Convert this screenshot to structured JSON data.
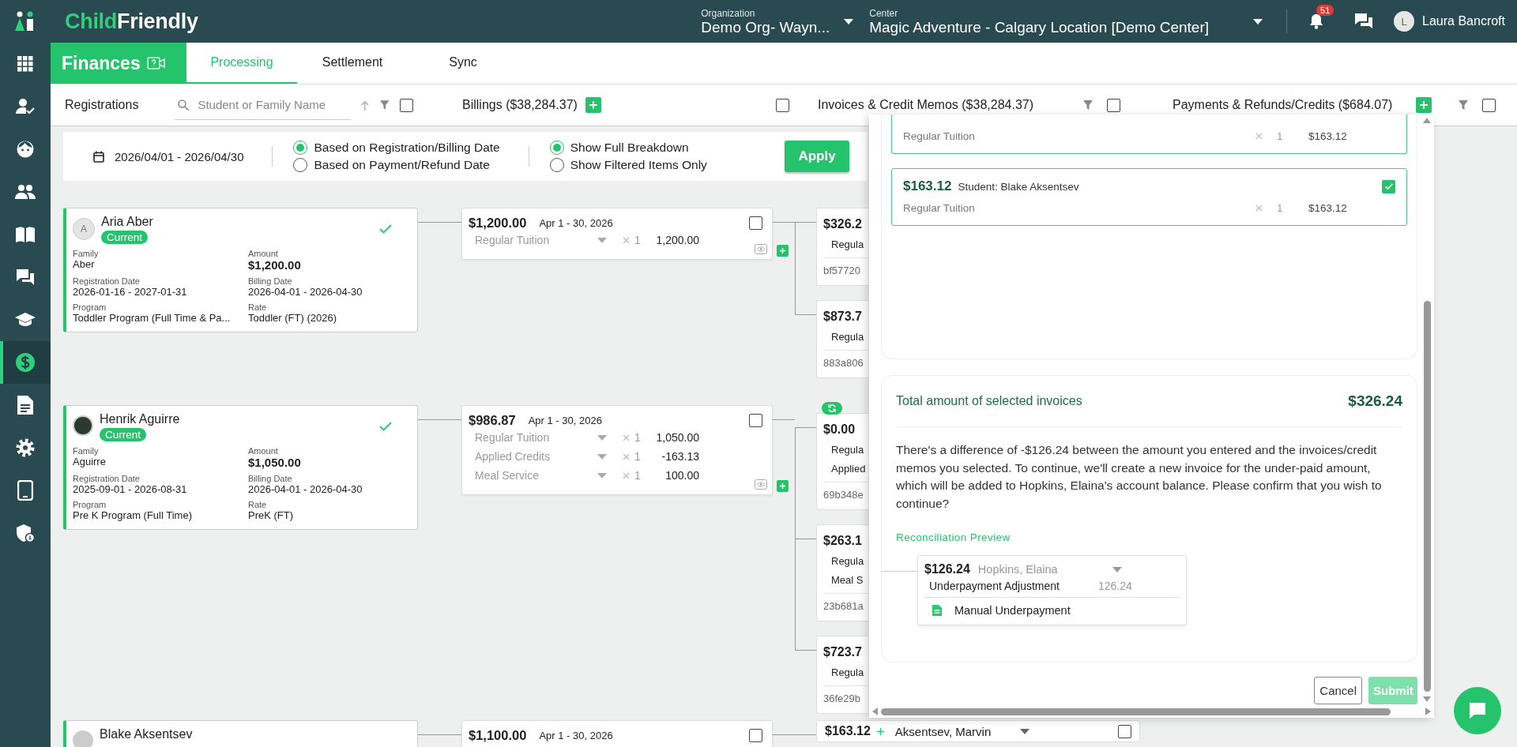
{
  "brand": {
    "wordmark": "ChildFriendly"
  },
  "topbar": {
    "organization": {
      "label": "Organization",
      "value": "Demo Org- Wayn..."
    },
    "center": {
      "label": "Center",
      "value": "Magic Adventure - Calgary Location [Demo Center]"
    },
    "notification_count": "51",
    "user": {
      "initial": "L",
      "name": "Laura Bancroft"
    }
  },
  "sidebar": {
    "items": [
      {
        "kind": "grid",
        "selected": false
      },
      {
        "kind": "person-check",
        "selected": false
      },
      {
        "kind": "face",
        "selected": false
      },
      {
        "kind": "people",
        "selected": false
      },
      {
        "kind": "book",
        "selected": false
      },
      {
        "kind": "chat",
        "selected": false
      },
      {
        "kind": "graduation",
        "selected": false
      },
      {
        "kind": "dollar",
        "selected": true
      },
      {
        "kind": "document",
        "selected": false
      },
      {
        "kind": "settings",
        "selected": false
      },
      {
        "kind": "tablet",
        "selected": false
      },
      {
        "kind": "shield",
        "selected": false
      }
    ]
  },
  "module": {
    "title": "Finances"
  },
  "tabs": [
    {
      "label": "Processing",
      "selected": true
    },
    {
      "label": "Settlement",
      "selected": false
    },
    {
      "label": "Sync",
      "selected": false
    }
  ],
  "columns": [
    {
      "kind": "registrations",
      "title": "Registrations",
      "search_placeholder": "Student or Family Name",
      "checked": false
    },
    {
      "kind": "billings",
      "title": "Billings ($38,284.37)",
      "checked": false
    },
    {
      "kind": "invoices",
      "title": "Invoices & Credit Memos ($38,284.37)",
      "checked": false
    },
    {
      "kind": "payments",
      "title": "Payments & Refunds/Credits ($684.07)",
      "checked": false
    }
  ],
  "filters": {
    "date_range": "2026/04/01 - 2026/04/30",
    "date_basis": [
      {
        "label": "Based on Registration/Billing Date",
        "selected": true
      },
      {
        "label": "Based on Payment/Refund Date",
        "selected": false
      }
    ],
    "display": [
      {
        "label": "Show Full Breakdown",
        "selected": true
      },
      {
        "label": "Show Filtered Items Only",
        "selected": false
      }
    ],
    "apply": "Apply"
  },
  "rows": [
    {
      "registration": {
        "name": "Aria Aber",
        "avatar": {
          "kind": "initial",
          "initial": "A"
        },
        "status": "Current",
        "approved": true,
        "fields": [
          {
            "label": "Family",
            "value": "Aber"
          },
          {
            "label": "Amount",
            "value": "$1,200.00"
          },
          {
            "label": "Registration Date",
            "value": "2026-01-16 - 2027-01-31"
          },
          {
            "label": "Billing Date",
            "value": "2026-04-01 - 2026-04-30"
          },
          {
            "label": "Program",
            "value": "Toddler Program (Full Time & Pa..."
          },
          {
            "label": "Rate",
            "value": "Toddler (FT) (2026)"
          }
        ]
      },
      "billing": {
        "amount": "$1,200.00",
        "period": "Apr 1 - 30, 2026",
        "checked": false,
        "preview": true,
        "lines": [
          {
            "item": "Regular Tuition",
            "qty": "1",
            "amount": "1,200.00"
          }
        ]
      },
      "invoices": [
        {
          "synced": false,
          "amount": "$326.2",
          "lines": [
            "Regula"
          ],
          "reference": "bf57720"
        },
        {
          "synced": false,
          "amount": "$873.7",
          "lines": [
            "Regula"
          ],
          "reference": "883a806"
        }
      ]
    },
    {
      "registration": {
        "name": "Henrik Aguirre",
        "avatar": {
          "kind": "photo"
        },
        "status": "Current",
        "approved": true,
        "fields": [
          {
            "label": "Family",
            "value": "Aguirre"
          },
          {
            "label": "Amount",
            "value": "$1,050.00"
          },
          {
            "label": "Registration Date",
            "value": "2025-09-01 - 2026-08-31"
          },
          {
            "label": "Billing Date",
            "value": "2026-04-01 - 2026-04-30"
          },
          {
            "label": "Program",
            "value": "Pre K Program (Full Time)"
          },
          {
            "label": "Rate",
            "value": "PreK (FT)"
          }
        ]
      },
      "billing": {
        "amount": "$986.87",
        "period": "Apr 1 - 30, 2026",
        "checked": false,
        "preview": true,
        "lines": [
          {
            "item": "Regular Tuition",
            "qty": "1",
            "amount": "1,050.00"
          },
          {
            "item": "Applied Credits",
            "qty": "1",
            "amount": "-163.13"
          },
          {
            "item": "Meal Service",
            "qty": "1",
            "amount": "100.00"
          }
        ]
      },
      "invoices": [
        {
          "synced": true,
          "amount": "$0.00",
          "lines": [
            "Regula",
            "Applied"
          ],
          "reference": "69b348e"
        },
        {
          "synced": false,
          "amount": "$263.1",
          "lines": [
            "Regula",
            "Meal S"
          ],
          "reference": "23b681a"
        },
        {
          "synced": false,
          "amount": "$723.7",
          "lines": [
            "Regula"
          ],
          "reference": "36fe29b"
        }
      ]
    },
    {
      "registration": {
        "name": "Blake Aksentsev",
        "avatar": {
          "kind": "blank"
        }
      },
      "billing": {
        "amount": "$1,100.00",
        "period": "Apr 1 - 30, 2026",
        "checked": false
      },
      "invoices": [
        {
          "synced": false,
          "amount": "$163.12",
          "payer": "Aksentsev, Marvin",
          "checked": false
        }
      ]
    }
  ],
  "reconcile_panel": {
    "invoices": [
      {
        "lines": [
          {
            "item": "Regular Tuition",
            "qty": "1",
            "amount": "$163.12"
          }
        ]
      },
      {
        "amount": "$163.12",
        "student": "Student: Blake Aksentsev",
        "checked": true,
        "lines": [
          {
            "item": "Regular Tuition",
            "qty": "1",
            "amount": "$163.12"
          }
        ]
      }
    ],
    "total_label": "Total amount of selected invoices",
    "total": "$326.24",
    "message": "There's a difference of -$126.24 between the amount you entered and the invoices/credit memos you selected. To continue, we'll create a new invoice for the under-paid amount, which will be added to Hopkins, Elaina's account balance. Please confirm that you wish to continue?",
    "preview_link": "Reconciliation Preview",
    "preview": {
      "amount": "$126.24",
      "account": "Hopkins, Elaina",
      "line": {
        "item": "Underpayment Adjustment",
        "amount": "126.24"
      },
      "memo": "Manual Underpayment"
    },
    "buttons": [
      {
        "label": "Cancel",
        "kind": "secondary",
        "disabled": false
      },
      {
        "label": "Submit",
        "kind": "primary",
        "disabled": true
      }
    ]
  }
}
